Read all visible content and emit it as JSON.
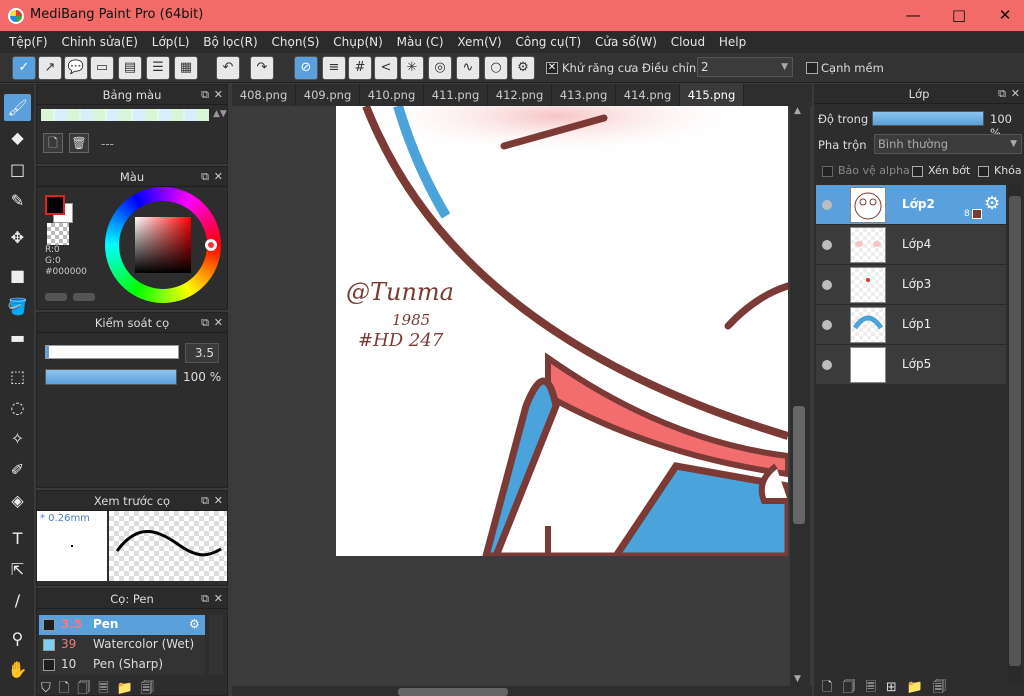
{
  "window": {
    "title": "MediBang Paint Pro (64bit)",
    "controls": [
      "—",
      "□",
      "✕"
    ]
  },
  "menu": [
    "Tệp(F)",
    "Chỉnh sửa(E)",
    "Lớp(L)",
    "Bộ lọc(R)",
    "Chọn(S)",
    "Chụp(N)",
    "Màu (C)",
    "Xem(V)",
    "Công cụ(T)",
    "Cửa sổ(W)",
    "Cloud",
    "Help"
  ],
  "toolbar": {
    "antialias_label": "Khử răng cưa",
    "antialias_check": "✕",
    "stabilizer_label": "Điều chỉnh",
    "stabilizer_value": "2",
    "soft_edge_label": "Cạnh mềm"
  },
  "palette": {
    "title": "Bảng màu",
    "name": "---"
  },
  "color": {
    "title": "Màu",
    "r": "R:0",
    "g": "G:0",
    "hex": "#000000",
    "fg": "#000000",
    "bg": "#ffffff"
  },
  "brush_control": {
    "title": "Kiểm soát cọ",
    "size": "3.5",
    "opacity": "100 %",
    "size_fraction": 0.02,
    "opacity_fraction": 1.0
  },
  "brush_preview": {
    "title": "Xem trước cọ",
    "size_label": "* 0.26mm"
  },
  "brush_list": {
    "title": "Cọ: Pen",
    "items": [
      {
        "size": "3.5",
        "name": "Pen",
        "swatch": "#1e1e1e"
      },
      {
        "size": "39",
        "name": "Watercolor (Wet)",
        "swatch": "#7fd0ef"
      },
      {
        "size": "10",
        "name": "Pen (Sharp)",
        "swatch": "#1e1e1e"
      }
    ]
  },
  "tabs": [
    "408.png",
    "409.png",
    "410.png",
    "411.png",
    "412.png",
    "413.png",
    "414.png",
    "415.png"
  ],
  "active_tab": "415.png",
  "canvas": {
    "signature_lines": [
      "@Tunma",
      "1985",
      "#HD 247"
    ]
  },
  "layers": {
    "title": "Lớp",
    "opacity_label": "Độ trong",
    "opacity_value": "100 %",
    "blend_label": "Pha trộn",
    "blend_value": "Bình thường",
    "protect_alpha": "Bảo vệ alpha",
    "clipping": "Xén bớt",
    "lock": "Khóa",
    "items": [
      {
        "name": "Lớp2",
        "selected": true,
        "badge": "8"
      },
      {
        "name": "Lớp4",
        "selected": false
      },
      {
        "name": "Lớp3",
        "selected": false
      },
      {
        "name": "Lớp1",
        "selected": false
      },
      {
        "name": "Lớp5",
        "selected": false
      }
    ]
  }
}
